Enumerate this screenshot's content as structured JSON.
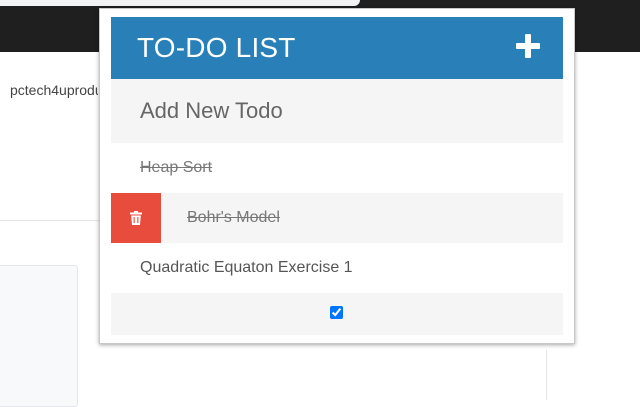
{
  "background_page": {
    "site_text": "pctech4uproduc"
  },
  "popup": {
    "header": {
      "title": "TO-DO LIST",
      "add_icon": "plus-icon"
    },
    "new_todo_input": {
      "placeholder": "Add New Todo",
      "value": ""
    },
    "todos": [
      {
        "text": "Heap Sort",
        "completed": true,
        "hovered": false
      },
      {
        "text": "Bohr's Model",
        "completed": true,
        "hovered": true
      },
      {
        "text": "Quadratic Equaton Exercise 1",
        "completed": false,
        "hovered": false
      }
    ],
    "delete_icon": "trash-icon",
    "footer_checkbox": {
      "checked": true
    }
  },
  "colors": {
    "header_bg": "#2980b9",
    "delete_bg": "#e74c3c",
    "browser_topbar": "#1f1f1f"
  }
}
